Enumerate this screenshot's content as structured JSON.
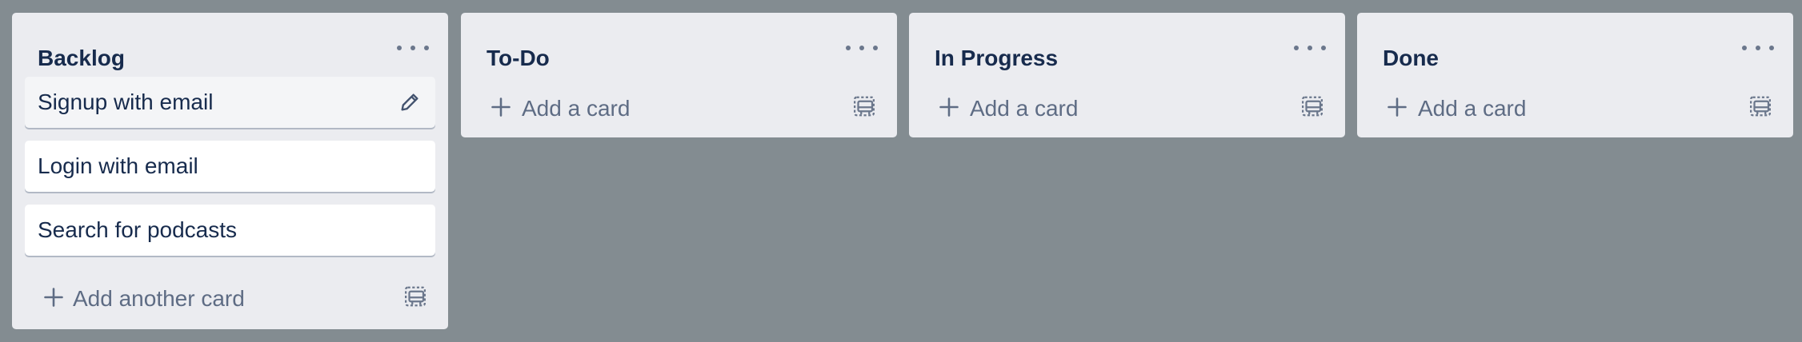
{
  "lists": [
    {
      "title": "Backlog",
      "cards": [
        {
          "title": "Signup with email"
        },
        {
          "title": "Login with email"
        },
        {
          "title": "Search for podcasts"
        }
      ],
      "add_label": "Add another card"
    },
    {
      "title": "To-Do",
      "cards": [],
      "add_label": "Add a card"
    },
    {
      "title": "In Progress",
      "cards": [],
      "add_label": "Add a card"
    },
    {
      "title": "Done",
      "cards": [],
      "add_label": "Add a card"
    }
  ],
  "colors": {
    "board_background": "#838c91",
    "list_background": "#ebecf0",
    "card_background": "#ffffff",
    "title_text": "#172b4d",
    "muted_text": "#5e6c84"
  },
  "icons": {
    "menu": "more-horizontal-icon",
    "edit": "pencil-icon",
    "add": "plus-icon",
    "template": "card-template-icon"
  }
}
